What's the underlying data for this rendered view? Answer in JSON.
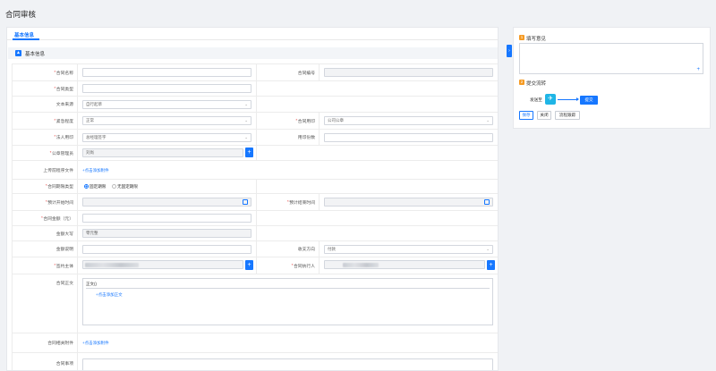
{
  "page_title": "合同审核",
  "tabs": [
    {
      "label": "基本信息"
    }
  ],
  "section": {
    "icon": "collapse-icon",
    "title": "基本信息"
  },
  "form": {
    "contract_name": {
      "label": "合同名称",
      "value": ""
    },
    "contract_no": {
      "label": "合同编号",
      "value": ""
    },
    "contract_type": {
      "label": "合同类型",
      "value": ""
    },
    "text_source": {
      "label": "文本来源",
      "value": "自行起草"
    },
    "urgency": {
      "label": "紧急程度",
      "value": "正常"
    },
    "seal": {
      "label": "合同用印",
      "value": "公司公章"
    },
    "legal_seal": {
      "label": "法人用印",
      "value": "总经理签字"
    },
    "seal_count": {
      "label": "用印份数",
      "value": ""
    },
    "seal_manager": {
      "label": "公章管理员",
      "value": "刘尚"
    },
    "pre_doc": {
      "label": "上传前程序文件",
      "link": "+点击添加附件"
    },
    "term_type": {
      "label": "合同期限类型",
      "options": [
        "固定期限",
        "无固定期限"
      ],
      "selected": "固定期限"
    },
    "start_time": {
      "label": "预计开始时间",
      "value": ""
    },
    "end_time": {
      "label": "预计结束时间",
      "value": ""
    },
    "amount": {
      "label": "合同金额（元）",
      "value": ""
    },
    "amount_upper": {
      "label": "金额大写",
      "value": "零元整"
    },
    "amount_desc": {
      "label": "金额说明",
      "value": ""
    },
    "direction": {
      "label": "收支方向",
      "value": "付款"
    },
    "party": {
      "label": "签约主体",
      "value": ""
    },
    "executor": {
      "label": "合同执行人",
      "value": ""
    },
    "body": {
      "label": "合同正文",
      "tag": "正文()",
      "link": "+点击添加正文"
    },
    "attachment": {
      "label": "合同相关附件",
      "link": "+点击添加附件"
    },
    "matters": {
      "label": "合同事项",
      "value": ""
    }
  },
  "side": {
    "opinion": {
      "num": "1",
      "title": "填写意见",
      "plus": "+"
    },
    "flow": {
      "num": "2",
      "title": "提交流转",
      "sender_label": "发送至",
      "node": "提交"
    },
    "buttons": {
      "save": "保存",
      "close": "关闭",
      "track": "流程跟踪"
    },
    "collapse": "›"
  },
  "colors": {
    "primary": "#1677ff",
    "required": "#e53935",
    "badge": "#f59a23"
  }
}
